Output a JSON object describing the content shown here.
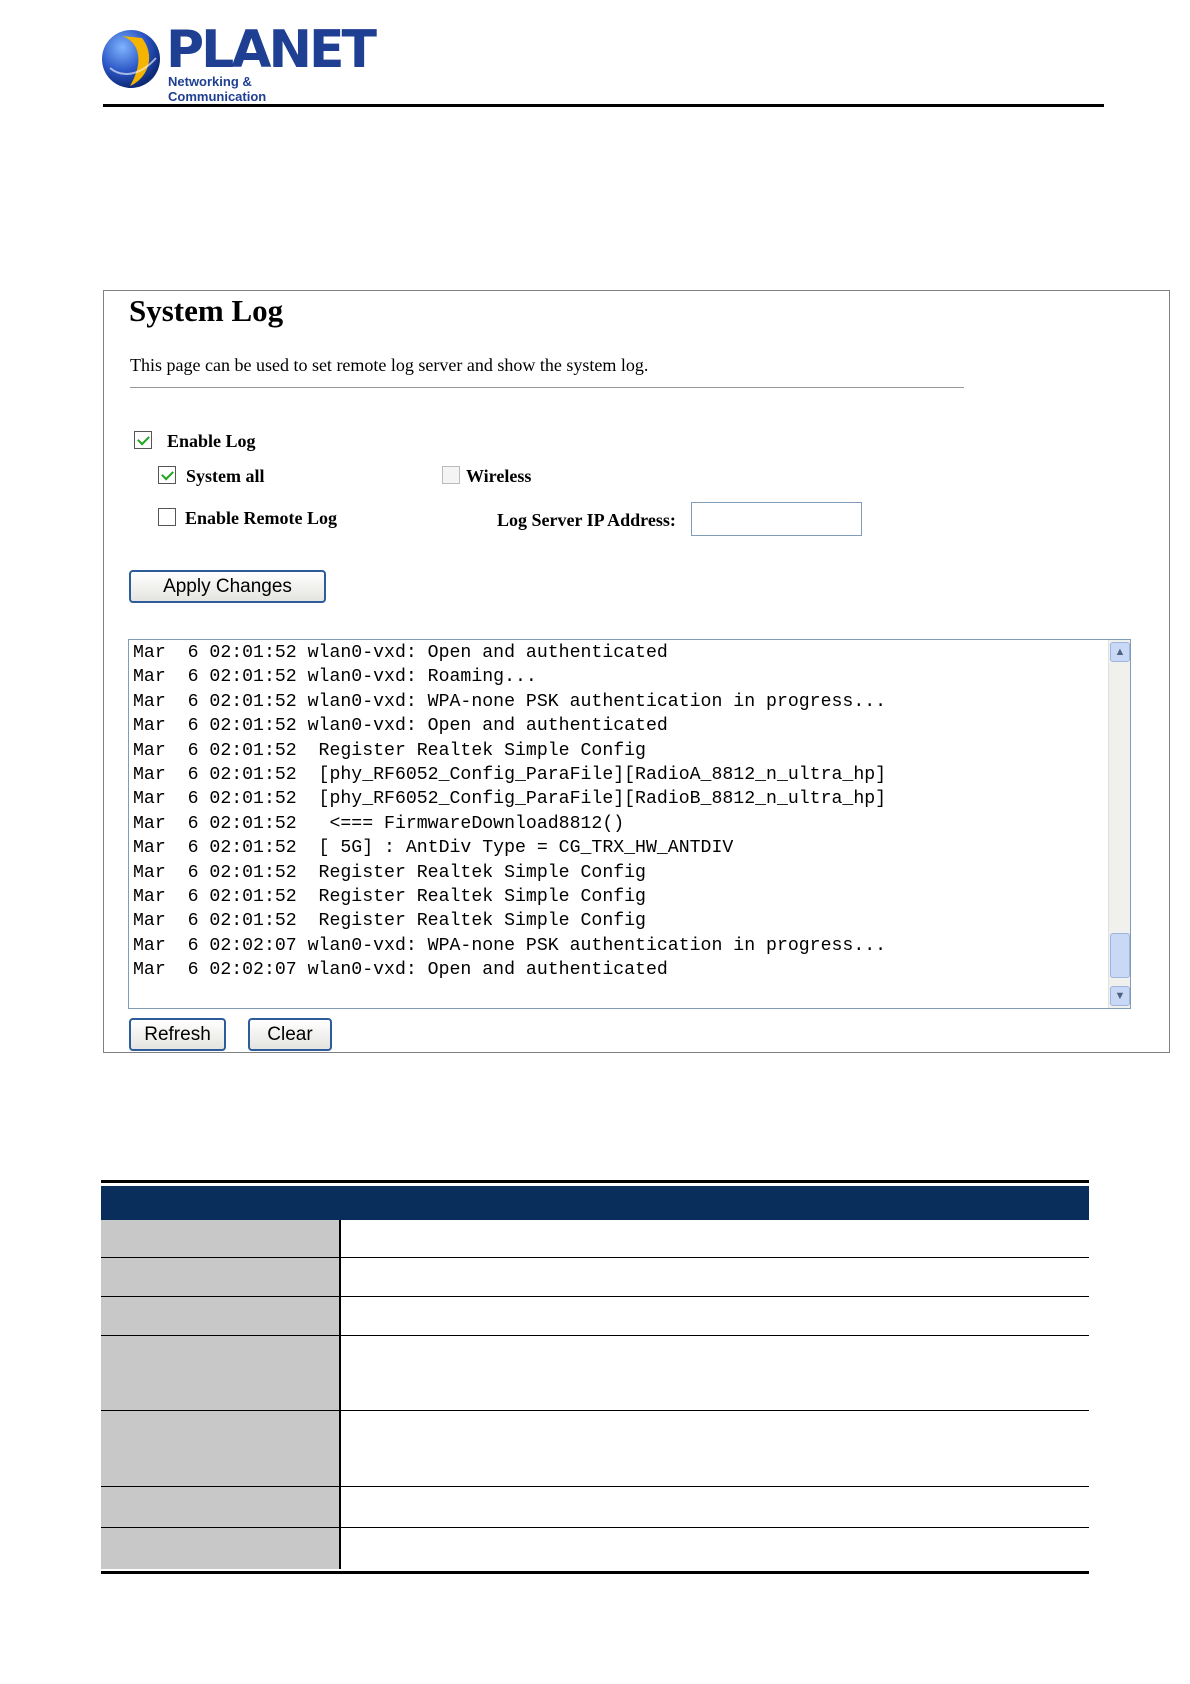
{
  "brand": {
    "name": "PLANET",
    "tagline": "Networking & Communication"
  },
  "panel": {
    "title": "System Log",
    "description": "This page can be used to set remote log server and show the system log.",
    "enable_log": {
      "label": "Enable Log",
      "checked": true
    },
    "system_all": {
      "label": "System all",
      "checked": true
    },
    "wireless": {
      "label": "Wireless",
      "checked": false,
      "disabled": true
    },
    "enable_remote_log": {
      "label": "Enable Remote Log",
      "checked": false
    },
    "log_server_ip": {
      "label": "Log Server IP Address:",
      "value": ""
    },
    "apply_button": "Apply Changes",
    "refresh_button": "Refresh",
    "clear_button": "Clear",
    "log_lines": [
      "Mar  6 02:01:52 wlan0-vxd: Open and authenticated",
      "Mar  6 02:01:52 wlan0-vxd: Roaming...",
      "Mar  6 02:01:52 wlan0-vxd: WPA-none PSK authentication in progress...",
      "Mar  6 02:01:52 wlan0-vxd: Open and authenticated",
      "Mar  6 02:01:52  Register Realtek Simple Config",
      "Mar  6 02:01:52  [phy_RF6052_Config_ParaFile][RadioA_8812_n_ultra_hp]",
      "Mar  6 02:01:52  [phy_RF6052_Config_ParaFile][RadioB_8812_n_ultra_hp]",
      "Mar  6 02:01:52   <=== FirmwareDownload8812()",
      "Mar  6 02:01:52  [ 5G] : AntDiv Type = CG_TRX_HW_ANTDIV",
      "Mar  6 02:01:52  Register Realtek Simple Config",
      "Mar  6 02:01:52  Register Realtek Simple Config",
      "Mar  6 02:01:52  Register Realtek Simple Config",
      "Mar  6 02:02:07 wlan0-vxd: WPA-none PSK authentication in progress...",
      "Mar  6 02:02:07 wlan0-vxd: Open and authenticated"
    ]
  },
  "colors": {
    "brand_blue": "#1f3f93",
    "table_header": "#0a2e5c",
    "table_label_bg": "#c8c8c8"
  },
  "table": {
    "rows": [
      "",
      "",
      "",
      "",
      "",
      "",
      ""
    ]
  }
}
